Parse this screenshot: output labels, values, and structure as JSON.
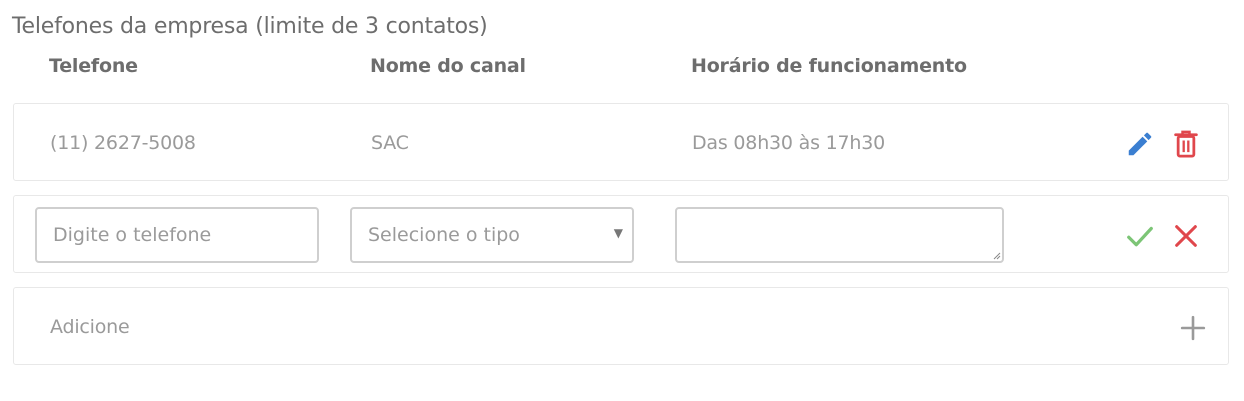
{
  "section": {
    "title": "Telefones da empresa (limite de 3 contatos)"
  },
  "columns": {
    "phone": "Telefone",
    "channel": "Nome do canal",
    "hours": "Horário de funcionamento"
  },
  "contacts": [
    {
      "phone": "(11) 2627-5008",
      "channel": "SAC",
      "hours": "Das 08h30 às 17h30"
    }
  ],
  "new_contact": {
    "phone_placeholder": "Digite o telefone",
    "type_placeholder": "Selecione o tipo",
    "hours_value": ""
  },
  "add_row": {
    "label": "Adicione"
  },
  "colors": {
    "edit": "#3b7fd1",
    "delete": "#e0474c",
    "confirm": "#7cc576",
    "cancel": "#e0474c",
    "add": "#9a9a9a"
  }
}
